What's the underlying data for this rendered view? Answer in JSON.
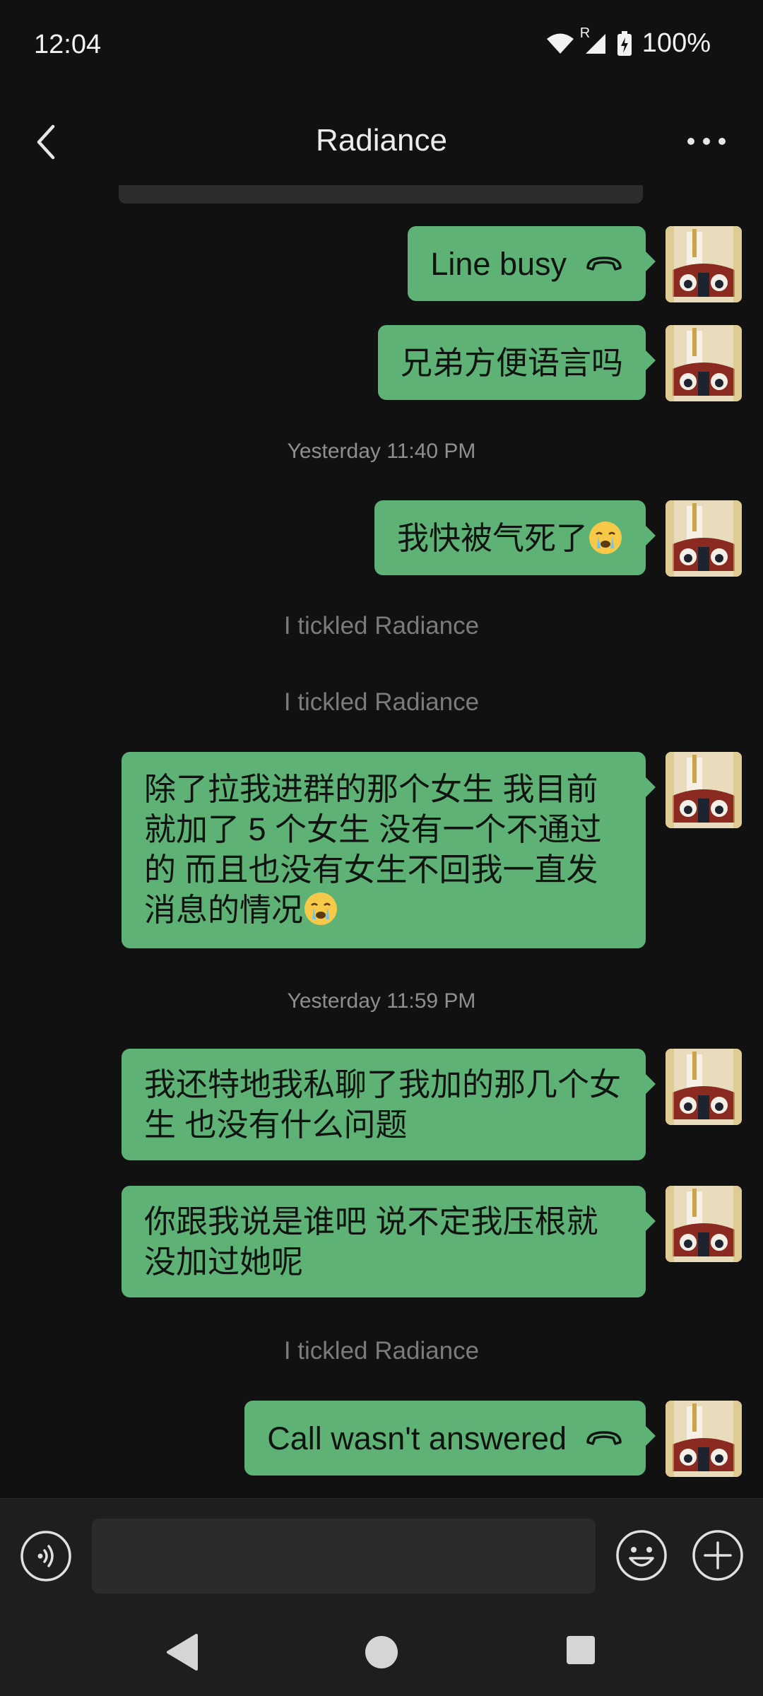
{
  "status_bar": {
    "time": "12:04",
    "roaming": "R",
    "battery": "100%",
    "icons": [
      "wifi-icon",
      "signal-icon",
      "battery-charging-icon"
    ]
  },
  "header": {
    "title": "Radiance",
    "back_icon": "chevron-left-icon",
    "more_icon": "more-dots-icon"
  },
  "messages": [
    {
      "type": "outgoing",
      "text": "Line busy",
      "icon": "call-ended-icon"
    },
    {
      "type": "outgoing",
      "text": "兄弟方便语言吗"
    },
    {
      "type": "timestamp",
      "text": "Yesterday 11:40 PM"
    },
    {
      "type": "outgoing",
      "text": "我快被气死了",
      "emoji": "crying-face"
    },
    {
      "type": "system",
      "text": "I  tickled Radiance"
    },
    {
      "type": "system",
      "text": "I  tickled Radiance"
    },
    {
      "type": "outgoing",
      "text": "除了拉我进群的那个女生 我目前就加了 5 个女生 没有一个不通过的 而且也没有女生不回我一直发消息的情况",
      "emoji": "crying-face"
    },
    {
      "type": "timestamp",
      "text": "Yesterday 11:59 PM"
    },
    {
      "type": "outgoing",
      "text": "我还特地我私聊了我加的那几个女生 也没有什么问题"
    },
    {
      "type": "outgoing",
      "text": "你跟我说是谁吧 说不定我压根就没加过她呢"
    },
    {
      "type": "system",
      "text": "I  tickled Radiance"
    },
    {
      "type": "outgoing",
      "text": "Call wasn't answered",
      "icon": "call-ended-icon"
    }
  ],
  "input_bar": {
    "placeholder": "",
    "voice_icon": "voice-input-icon",
    "emoji_icon": "emoji-icon",
    "plus_icon": "add-icon"
  },
  "colors": {
    "background": "#111111",
    "bubble": "#5fb276",
    "bar": "#1e1e1e"
  }
}
